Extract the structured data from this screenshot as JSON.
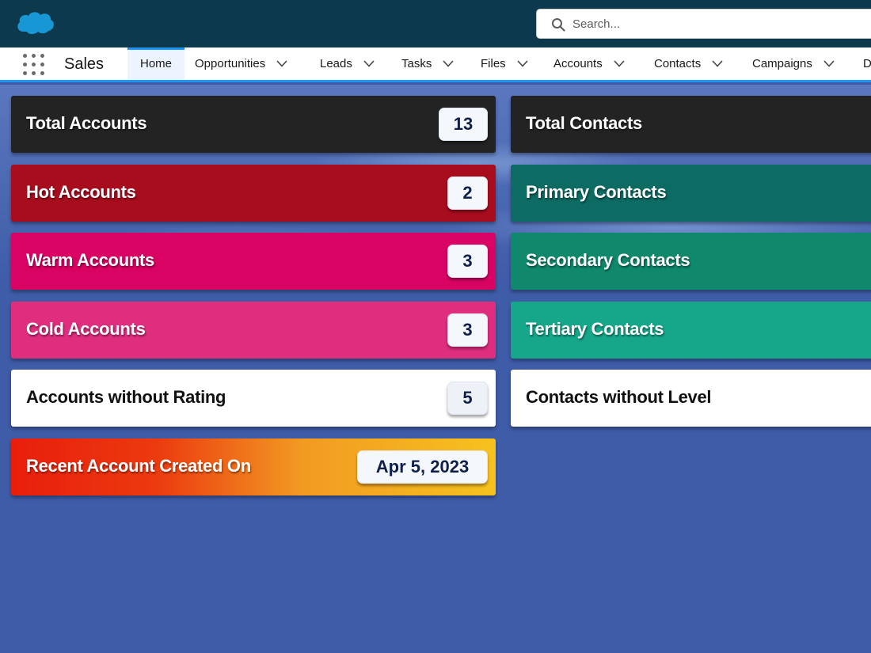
{
  "header": {
    "search_placeholder": "Search..."
  },
  "nav": {
    "app_name": "Sales",
    "items": [
      {
        "label": "Home"
      },
      {
        "label": "Opportunities"
      },
      {
        "label": "Leads"
      },
      {
        "label": "Tasks"
      },
      {
        "label": "Files"
      },
      {
        "label": "Accounts"
      },
      {
        "label": "Contacts"
      },
      {
        "label": "Campaigns"
      },
      {
        "label": "D"
      }
    ]
  },
  "accounts": {
    "total": {
      "label": "Total Accounts",
      "count": "13",
      "color": "#232323"
    },
    "hot": {
      "label": "Hot Accounts",
      "count": "2",
      "color": "#a80d1e"
    },
    "warm": {
      "label": "Warm Accounts",
      "count": "3",
      "color": "#d90364"
    },
    "cold": {
      "label": "Cold Accounts",
      "count": "3",
      "color": "#df2e7e"
    },
    "unrated": {
      "label": "Accounts without Rating",
      "count": "5",
      "color": "#ffffff"
    },
    "recent": {
      "label": "Recent Account Created On",
      "value": "Apr 5, 2023"
    }
  },
  "contacts": {
    "total": {
      "label": "Total Contacts",
      "color": "#232323"
    },
    "primary": {
      "label": "Primary Contacts",
      "color": "#0c6b62"
    },
    "secondary": {
      "label": "Secondary Contacts",
      "color": "#10886c"
    },
    "tertiary": {
      "label": "Tertiary Contacts",
      "color": "#16a68a"
    },
    "unleveled": {
      "label": "Contacts without Level",
      "color": "#ffffff"
    }
  }
}
